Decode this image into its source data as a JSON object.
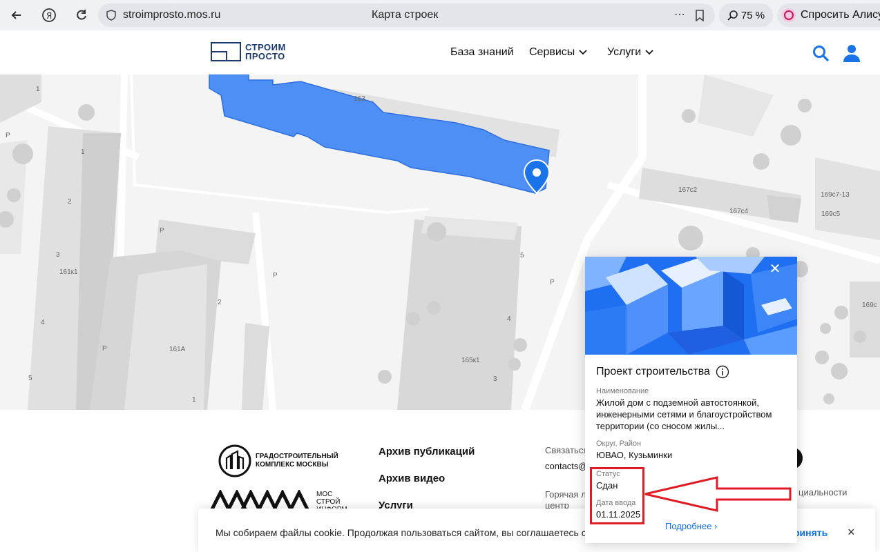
{
  "browser": {
    "url": "stroimprosto.mos.ru",
    "page_title": "Карта строек",
    "zoom": "75 %",
    "alice": "Спросить Алису"
  },
  "header": {
    "logo_line1": "СТРОИМ",
    "logo_line2": "ПРОСТО",
    "nav": [
      "База знаний",
      "Сервисы",
      "Услуги"
    ]
  },
  "map": {
    "labels": [
      "163",
      "167с2",
      "167с4",
      "169с7-13",
      "169с5",
      "169с",
      "161к1",
      "161А",
      "165к1",
      "1",
      "1",
      "2",
      "3",
      "4",
      "5",
      "2",
      "4",
      "3",
      "1",
      "5",
      "P",
      "P",
      "P",
      "P",
      "P"
    ]
  },
  "card": {
    "title": "Проект строительства",
    "name_label": "Наименование",
    "name_value": "Жилой дом с подземной автостоянкой, инженерными сетями и благоустройством территории (со сносом жилы...",
    "district_label": "Округ, Район",
    "district_value": "ЮВАО, Кузьминки",
    "status_label": "Статус",
    "status_value": "Сдан",
    "date_label": "Дата ввода",
    "date_value": "01.11.2025",
    "more": "Подробнее ›"
  },
  "footer": {
    "logo1": "ГРАДОСТРОИТЕЛЬНЫЙ КОМПЛЕКС МОСКВЫ",
    "logo2_line1": "МОС",
    "logo2_line2": "СТРОЙ",
    "logo2_line3": "ИНФОРМ",
    "links": [
      "Архив публикаций",
      "Архив видео",
      "Услуги"
    ],
    "contact_label": "Связаться",
    "contact_email": "contacts@",
    "hotline": "Горячая л",
    "hotline2": "центр",
    "privacy": "циальности"
  },
  "cookie": {
    "text": "Мы собираем файлы cookie. Продолжая пользоваться сайтом, вы соглашаетесь с",
    "accept": "ринять",
    "close": "×"
  },
  "colors": {
    "accent": "#1a73e8",
    "building_highlight": "#4d8ff5",
    "annotation": "#e01b24"
  }
}
